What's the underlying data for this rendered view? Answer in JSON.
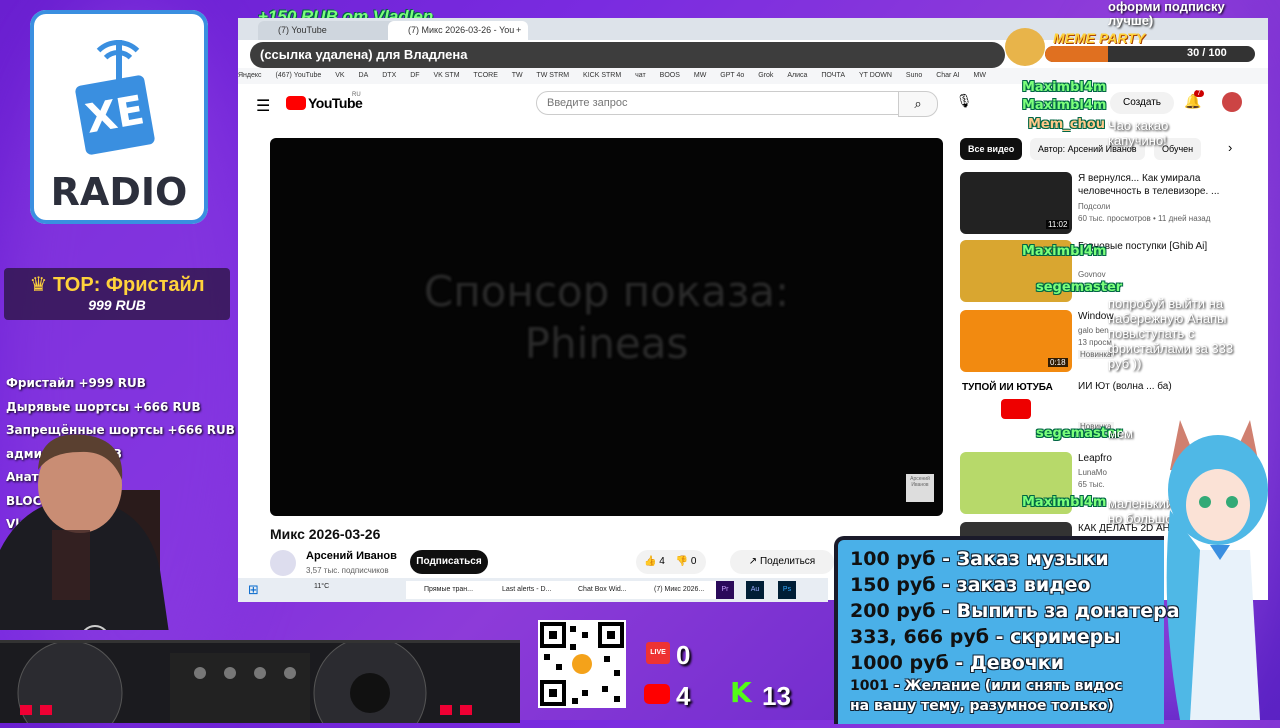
{
  "donation_alert": "+150 RUB  от  Vladlen",
  "logo": {
    "brand": "XE",
    "text": "RADIO"
  },
  "top_donor": {
    "title": "TOP: Фристайл",
    "amount": "999 RUB"
  },
  "donations": [
    "Фристайл +999 RUB",
    "Дырявые шортсы +666 RUB",
    "Запрещённые шортсы +666 RUB",
    "админ +300 RUB",
    "Анато 3",
    "BLOCK",
    "Vladl"
  ],
  "browser": {
    "tabs": [
      "(7) YouTube",
      "(7) Микс 2026-03-26 - You"
    ],
    "new_tab": "+",
    "alert_text": "(ссылка удалена) для Владлена",
    "bookmarks": [
      "Яндекс",
      "(467) YouTube",
      "VK",
      "DA",
      "DTX",
      "DF",
      "VK STM",
      "TCORE",
      "TW",
      "TW STRM",
      "KICK STRM",
      "чат",
      "BOOS",
      "MW",
      "GPT 4o",
      "Grok",
      "Алиса",
      "ПОЧТА",
      "YT DOWN",
      "Suno",
      "Char AI",
      "MW"
    ]
  },
  "youtube": {
    "logo_text": "YouTube",
    "logo_region": "RU",
    "search_placeholder": "Введите запрос",
    "create_label": "Создать",
    "notif_count": "7",
    "video_overlay_text_1": "Спонсор показа:",
    "video_overlay_text_2": "Phineas",
    "watermark": "Арсений Иванов",
    "video_title": "Микс 2026-03-26",
    "channel_name": "Арсений Иванов",
    "subscribers": "3,57 тыс. подписчиков",
    "subscribe_label": "Подписаться",
    "likes": "4",
    "dislikes": "0",
    "share_label": "Поделиться",
    "filter_chips": [
      "Все видео",
      "Автор: Арсений Иванов",
      "Обучен"
    ],
    "sidebar": [
      {
        "title": "Я вернулся... Как умирала человечность в телевизоре. ...",
        "channel": "Подсоли",
        "meta": "60 тыс. просмотров • 11 дней назад",
        "duration": "11:02"
      },
      {
        "title": "Говновые поступки [Ghib Ai]",
        "channel": "Govnov",
        "meta": "1 год назад",
        "duration": ""
      },
      {
        "title": "Window",
        "channel": "galo ben",
        "meta": "13 просм",
        "badge": "Новинка",
        "duration": "0:18"
      },
      {
        "title": "ИИ Ют (волна ... ба)",
        "channel": "ТУПОЙ ИИ ЮТУБА",
        "meta": "",
        "badge": "Новинка",
        "duration": ""
      },
      {
        "title": "Leapfro",
        "channel": "LunaMo",
        "meta": "65 тыс.",
        "duration": ""
      },
      {
        "title": "КАК ДЕЛАТЬ 2D АНИМ... ПРОСТ...",
        "channel": "",
        "meta": "",
        "duration": ""
      }
    ]
  },
  "taskbar": {
    "weather": "11°C",
    "items": [
      "Прямые тран...",
      "Last alerts - D...",
      "Chat Box Wid...",
      "(7) Микс 2026..."
    ]
  },
  "meme_party": {
    "title": "MEME PARTY",
    "progress": "30 / 100"
  },
  "chat": [
    {
      "user": "Maximbl4m",
      "msg": ""
    },
    {
      "user": "Maximbl4m",
      "msg": ""
    },
    {
      "user": "Mem_chou",
      "msg": "Чао какао капучино!"
    },
    {
      "user": "Maximbl4m",
      "msg": ""
    },
    {
      "user": "segemaster",
      "msg": "попробуй выйти на набережную Анапы повыступать с фристайлами за 333 руб ))"
    },
    {
      "user": "segemaster",
      "msg": "мем"
    },
    {
      "user": "Maximbl4m",
      "msg": "маленький но большой"
    }
  ],
  "top_right_text": "оформи подписку лучше)",
  "prices": [
    {
      "price": "100 руб",
      "desc": "- Заказ музыки"
    },
    {
      "price": "150 руб",
      "desc": "- заказ видео"
    },
    {
      "price": "200 руб",
      "desc": "- Выпить за донатера"
    },
    {
      "price": "333, 666 руб",
      "desc": "- скримеры"
    },
    {
      "price": "1000 руб",
      "desc": "- Девочки"
    },
    {
      "price": "1001",
      "desc": "- Желание (или снять видос"
    },
    {
      "price": "",
      "desc": "на вашу тему, разумное только)"
    }
  ],
  "counters": {
    "live": "0",
    "youtube": "4",
    "kick": "13",
    "live_label": "LIVE"
  },
  "colors": {
    "bg": "#7a2be0",
    "chat_name": "#7bff7b",
    "price_box": "#4ab0e8",
    "yt_red": "#ff0000"
  }
}
